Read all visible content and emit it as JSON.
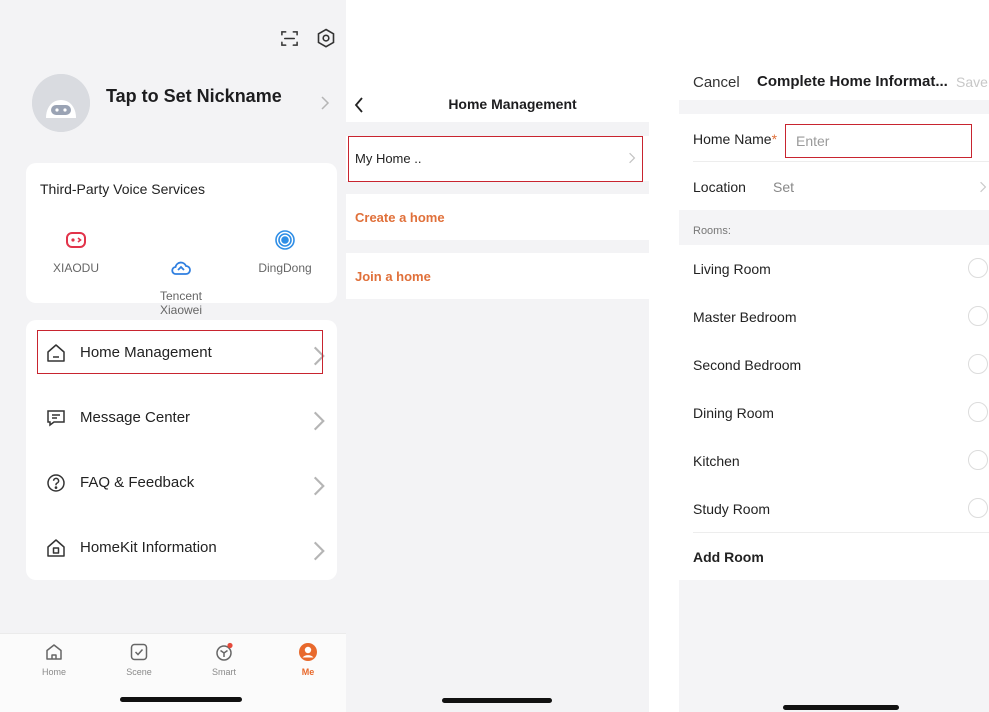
{
  "me_screen": {
    "top_icons": [
      "scan-icon",
      "settings-icon"
    ],
    "nickname": "Tap to Set Nickname",
    "voice_services": {
      "title": "Third-Party Voice Services",
      "items": [
        {
          "label": "XIAODU",
          "icon": "xiaodu-icon",
          "color": "#e2334a"
        },
        {
          "label": "Tencent\nXiaowei",
          "icon": "cloud-icon",
          "color": "#2f7fe0"
        },
        {
          "label": "DingDong",
          "icon": "dingdong-icon",
          "color": "#2f8ee6"
        }
      ]
    },
    "menu": [
      {
        "label": "Home Management",
        "icon": "home-outline-icon",
        "highlighted": true
      },
      {
        "label": "Message Center",
        "icon": "message-icon"
      },
      {
        "label": "FAQ & Feedback",
        "icon": "question-icon"
      },
      {
        "label": "HomeKit Information",
        "icon": "homekit-icon"
      }
    ],
    "tabs": [
      {
        "label": "Home",
        "icon": "home-tab-icon"
      },
      {
        "label": "Scene",
        "icon": "scene-tab-icon"
      },
      {
        "label": "Smart",
        "icon": "smart-tab-icon",
        "badge": true
      },
      {
        "label": "Me",
        "icon": "me-tab-icon",
        "active": true
      }
    ]
  },
  "home_management": {
    "title": "Home Management",
    "homes": [
      {
        "label": "My Home ..",
        "highlighted": true
      }
    ],
    "create_label": "Create a home",
    "join_label": "Join a home"
  },
  "complete_home": {
    "cancel": "Cancel",
    "title": "Complete Home Informat...",
    "save": "Save",
    "home_name_label": "Home Name",
    "required_mark": "*",
    "home_name_placeholder": "Enter",
    "home_name_value": "",
    "location_label": "Location",
    "location_value": "Set",
    "rooms_caption": "Rooms:",
    "rooms": [
      "Living Room",
      "Master Bedroom",
      "Second Bedroom",
      "Dining Room",
      "Kitchen",
      "Study Room"
    ],
    "add_room": "Add Room"
  },
  "colors": {
    "accent": "#e0703a",
    "highlight_box": "#c8242f",
    "background": "#f3f3f5"
  }
}
